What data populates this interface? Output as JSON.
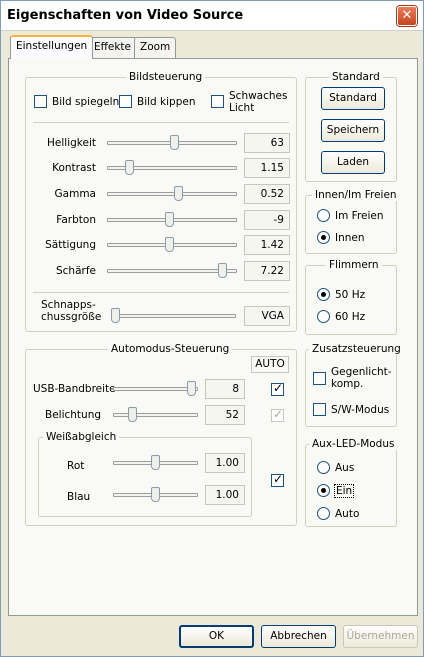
{
  "window": {
    "title": "Eigenschaften von Video Source"
  },
  "tabs": [
    "Einstellungen",
    "Effekte",
    "Zoom"
  ],
  "bildsteuerung": {
    "legend": "Bildsteuerung",
    "checks": [
      {
        "label": "Bild spiegeln",
        "checked": false
      },
      {
        "label": "Bild kippen",
        "checked": false
      },
      {
        "label_line1": "Schwaches",
        "label_line2": "Licht",
        "checked": false
      }
    ],
    "sliders": [
      {
        "label": "Helligkeit",
        "value": "63",
        "pos": 0.52
      },
      {
        "label": "Kontrast",
        "value": "1.15",
        "pos": 0.15
      },
      {
        "label": "Gamma",
        "value": "0.52",
        "pos": 0.55
      },
      {
        "label": "Farbton",
        "value": "-9",
        "pos": 0.48
      },
      {
        "label": "Sättigung",
        "value": "1.42",
        "pos": 0.48
      },
      {
        "label": "Schärfe",
        "value": "7.22",
        "pos": 0.92
      }
    ],
    "resolution": {
      "label_line1": "Schnapps-",
      "label_line2": "chussgröße",
      "value": "VGA",
      "pos": 0.0
    }
  },
  "standard": {
    "legend": "Standard",
    "buttons": [
      "Standard",
      "Speichern",
      "Laden"
    ]
  },
  "innen_freien": {
    "legend": "Innen/Im Freien",
    "options": [
      {
        "label": "Im Freien",
        "checked": false
      },
      {
        "label": "Innen",
        "checked": true
      }
    ]
  },
  "flimmern": {
    "legend": "Flimmern",
    "options": [
      {
        "label": "50 Hz",
        "checked": true
      },
      {
        "label": "60 Hz",
        "checked": false
      }
    ]
  },
  "automodus": {
    "legend": "Automodus-Steuerung",
    "auto_label": "AUTO",
    "sliders": [
      {
        "label": "USB-Bandbreite",
        "value": "8",
        "pos": 0.97,
        "auto": true,
        "auto_disabled": false
      },
      {
        "label": "Belichtung",
        "value": "52",
        "pos": 0.2,
        "auto": true,
        "auto_disabled": true
      }
    ],
    "weissabgleich": {
      "legend": "Weißabgleich",
      "sliders": [
        {
          "label": "Rot",
          "value": "1.00",
          "pos": 0.5
        },
        {
          "label": "Blau",
          "value": "1.00",
          "pos": 0.5
        }
      ],
      "auto": true
    }
  },
  "zusatzsteuerung": {
    "legend": "Zusatzsteuerung",
    "checks": [
      {
        "label_line1": "Gegenlicht-",
        "label_line2": "komp.",
        "checked": false
      },
      {
        "label": "S/W-Modus",
        "checked": false
      }
    ]
  },
  "aux_led": {
    "legend": "Aux-LED-Modus",
    "options": [
      {
        "label": "Aus",
        "checked": false
      },
      {
        "label": "Ein",
        "checked": true
      },
      {
        "label": "Auto",
        "checked": false
      }
    ]
  },
  "footer": {
    "ok": "OK",
    "cancel": "Abbrechen",
    "apply": "Übernehmen"
  }
}
